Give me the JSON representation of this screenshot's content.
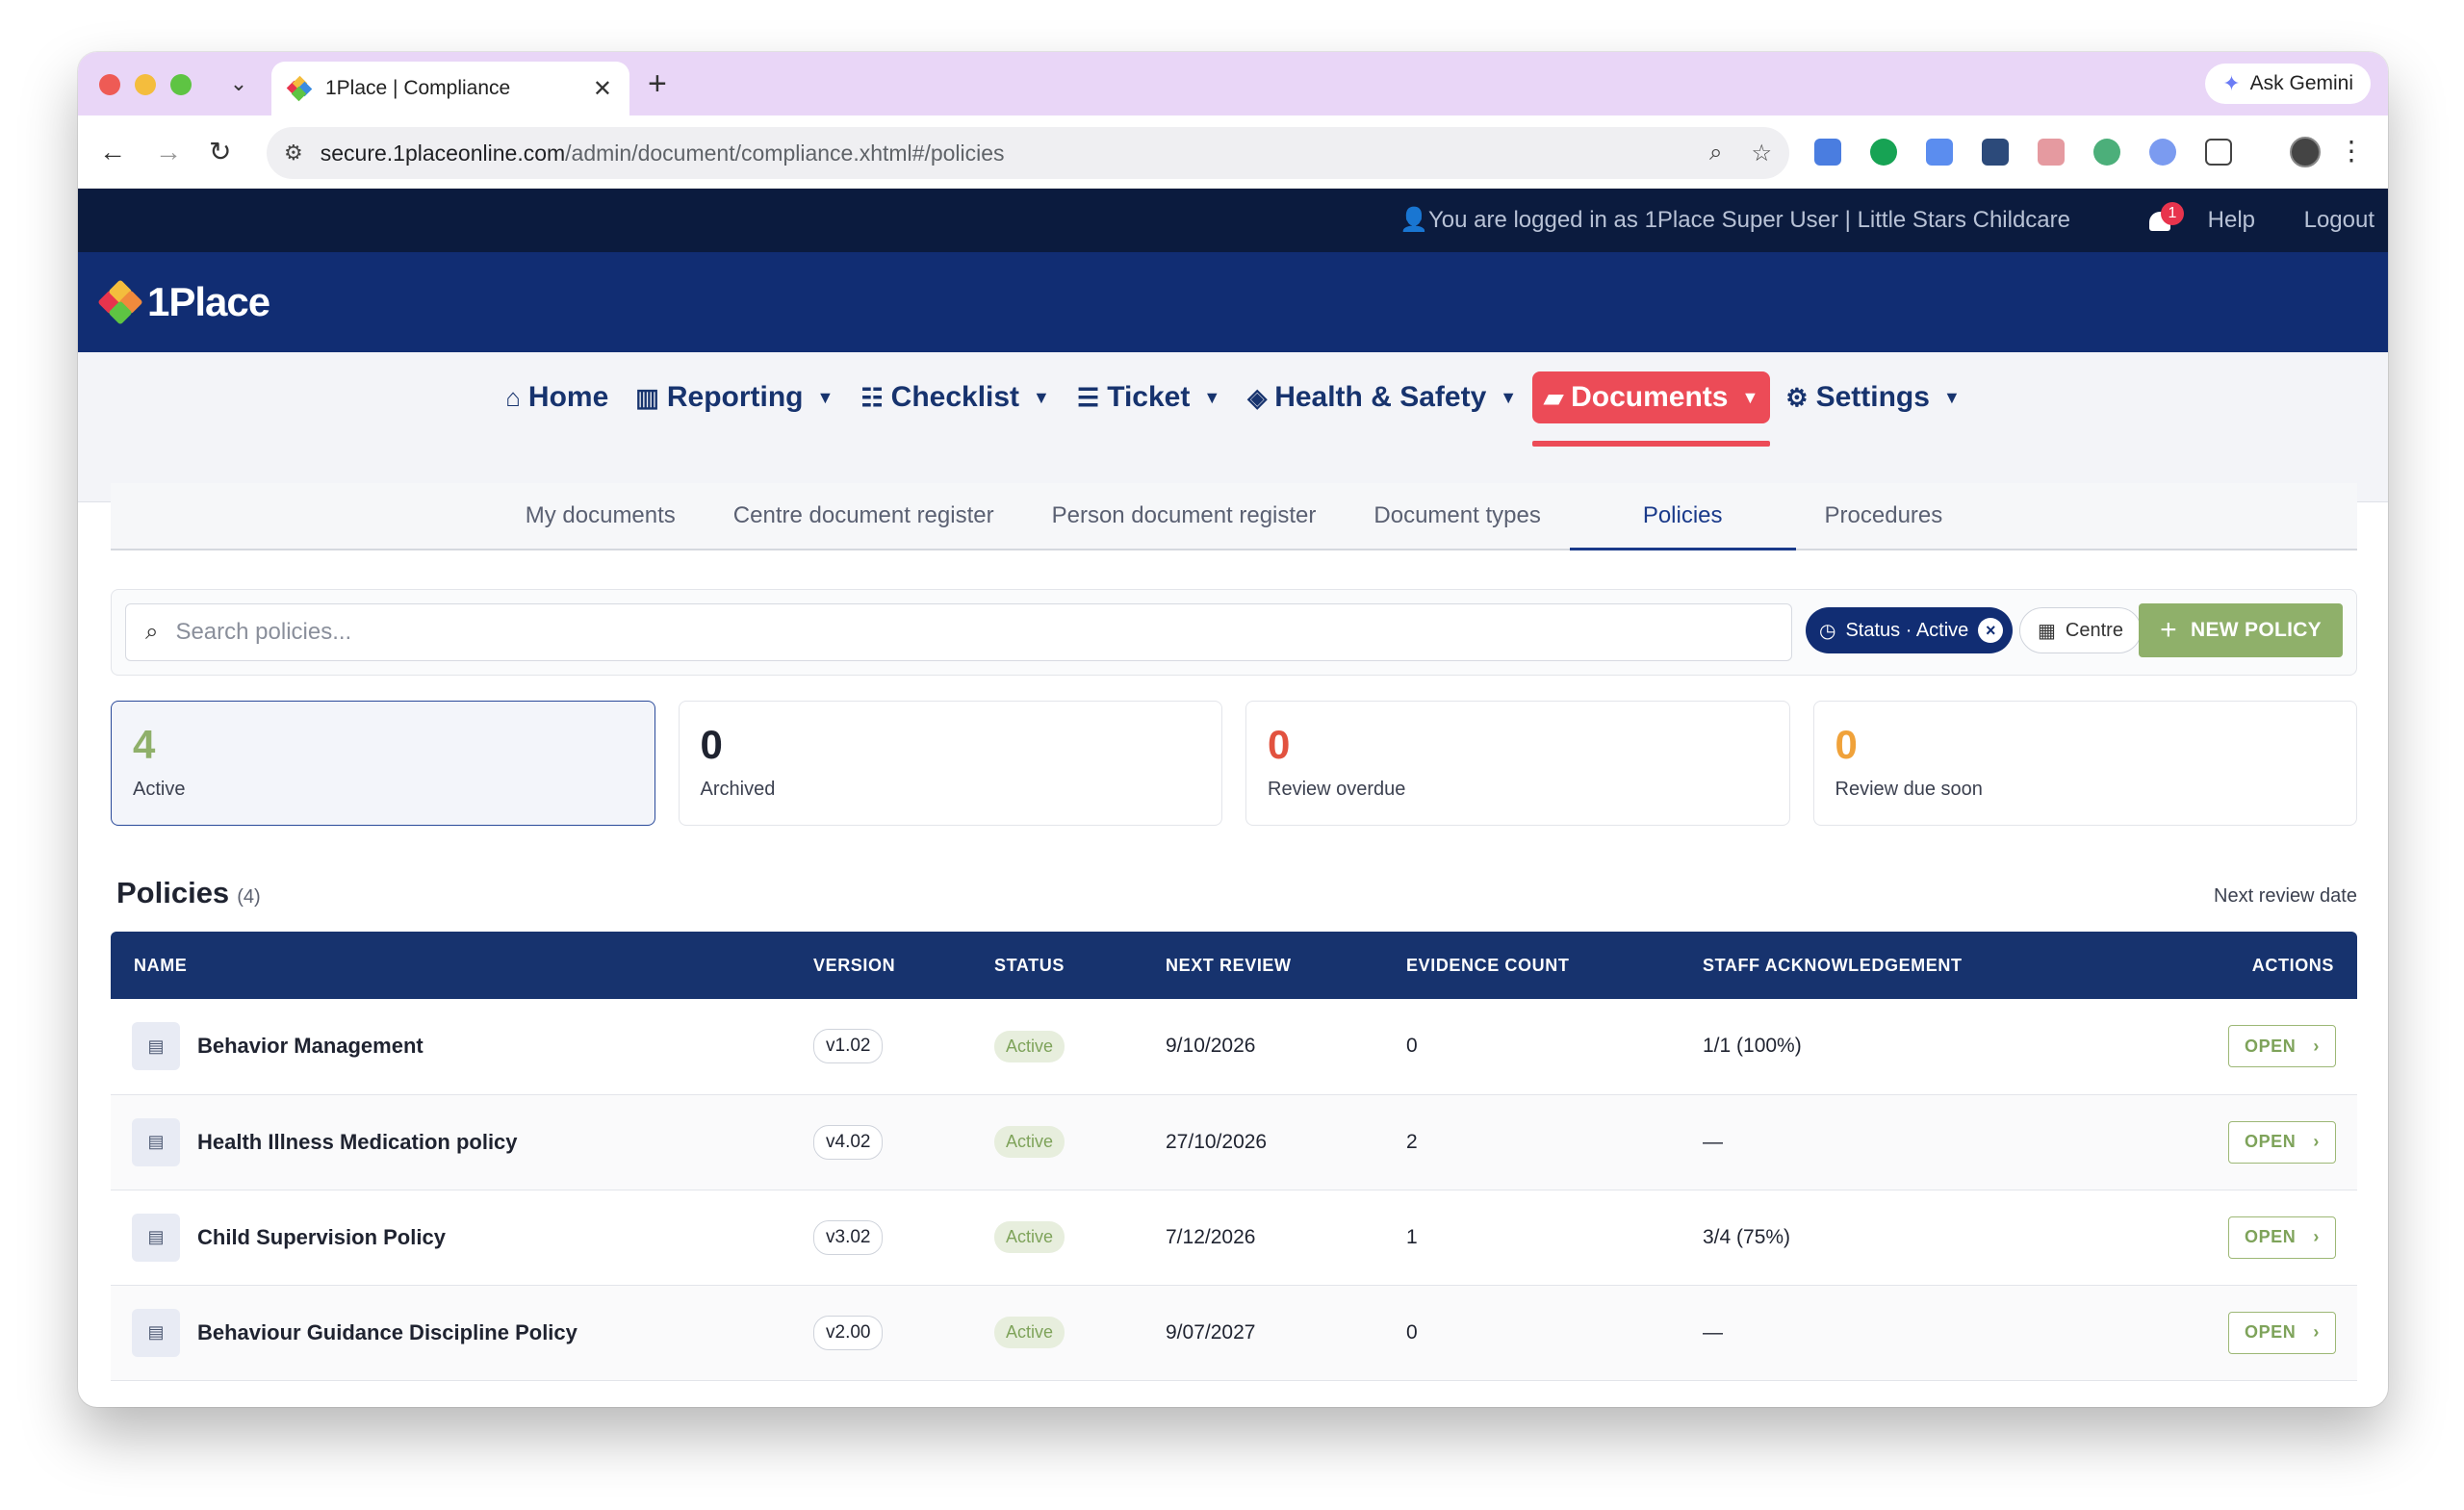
{
  "browser": {
    "tab_title": "1Place | Compliance",
    "url_host": "secure.1placeonline.com",
    "url_path": "/admin/document/compliance.xhtml#/policies",
    "ask_gemini": "Ask Gemini"
  },
  "topbar": {
    "login_text": "You are logged in as  1Place Super User | Little Stars Childcare",
    "notification_count": "1",
    "help": "Help",
    "logout": "Logout"
  },
  "brand": {
    "logo_text": "1Place"
  },
  "nav": {
    "items": [
      {
        "label": "Home",
        "icon": "home-icon"
      },
      {
        "label": "Reporting",
        "icon": "chart-icon"
      },
      {
        "label": "Checklist",
        "icon": "checklist-icon"
      },
      {
        "label": "Ticket",
        "icon": "ticket-icon"
      },
      {
        "label": "Health & Safety",
        "icon": "shield-icon"
      },
      {
        "label": "Documents",
        "icon": "folder-icon"
      },
      {
        "label": "Settings",
        "icon": "gear-icon"
      }
    ],
    "active": "Documents"
  },
  "subnav": {
    "tabs": [
      "My documents",
      "Centre document register",
      "Person document register",
      "Document types",
      "Policies",
      "Procedures"
    ],
    "active": "Policies"
  },
  "toolbar": {
    "search_placeholder": "Search policies...",
    "status_chip": "Status · Active",
    "centre_chip": "Centre",
    "new_button": "NEW POLICY"
  },
  "stats": [
    {
      "value": "4",
      "label": "Active",
      "color": "#8fb06a"
    },
    {
      "value": "0",
      "label": "Archived",
      "color": "#1f2330"
    },
    {
      "value": "0",
      "label": "Review overdue",
      "color": "#e2523f"
    },
    {
      "value": "0",
      "label": "Review due soon",
      "color": "#f0a23a"
    }
  ],
  "policies_section": {
    "title": "Policies",
    "count": "(4)",
    "sort_label": "Next review date"
  },
  "table": {
    "headers": [
      "NAME",
      "VERSION",
      "STATUS",
      "NEXT REVIEW",
      "EVIDENCE COUNT",
      "STAFF ACKNOWLEDGEMENT",
      "ACTIONS"
    ],
    "rows": [
      {
        "name": "Behavior Management",
        "version": "v1.02",
        "status": "Active",
        "next_review": "9/10/2026",
        "evidence": "0",
        "ack": "1/1 (100%)",
        "action": "OPEN"
      },
      {
        "name": "Health Illness Medication policy",
        "version": "v4.02",
        "status": "Active",
        "next_review": "27/10/2026",
        "evidence": "2",
        "ack": "—",
        "action": "OPEN"
      },
      {
        "name": "Child Supervision Policy",
        "version": "v3.02",
        "status": "Active",
        "next_review": "7/12/2026",
        "evidence": "1",
        "ack": "3/4 (75%)",
        "action": "OPEN"
      },
      {
        "name": "Behaviour Guidance Discipline Policy",
        "version": "v2.00",
        "status": "Active",
        "next_review": "9/07/2027",
        "evidence": "0",
        "ack": "—",
        "action": "OPEN"
      }
    ]
  }
}
